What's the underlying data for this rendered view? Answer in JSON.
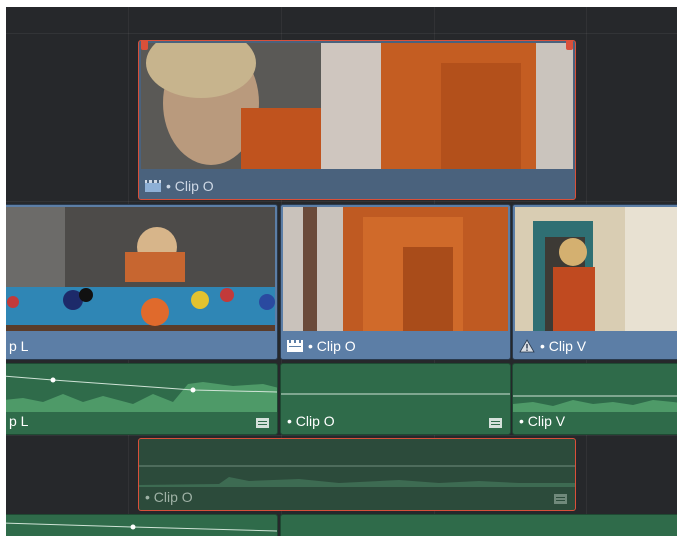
{
  "timeline": {
    "track_v2": {
      "clips": [
        {
          "name": "Clip O",
          "label": "• Clip O",
          "icon": "clapper-icon",
          "selected": true
        }
      ]
    },
    "track_v1": {
      "clips": [
        {
          "name": "Clip L",
          "label": "p L"
        },
        {
          "name": "Clip O",
          "label": "• Clip O",
          "icon": "clapper-icon"
        },
        {
          "name": "Clip V",
          "label": "• Clip V",
          "icon": "warning-icon"
        }
      ]
    },
    "track_a1": {
      "clips": [
        {
          "name": "Clip L",
          "label": "p L",
          "icon": "audio-clip-menu-icon"
        },
        {
          "name": "Clip O",
          "label": "• Clip O",
          "icon": "audio-clip-menu-icon"
        },
        {
          "name": "Clip V",
          "label": "• Clip V"
        }
      ]
    },
    "track_a2": {
      "clips": [
        {
          "name": "Clip O",
          "label": "• Clip O",
          "icon": "audio-clip-menu-icon",
          "selected": true
        }
      ]
    }
  },
  "colors": {
    "video_clip": "#5c7ea6",
    "audio_clip": "#2f6b4a",
    "selection": "#d9503a",
    "background": "#26282b"
  }
}
